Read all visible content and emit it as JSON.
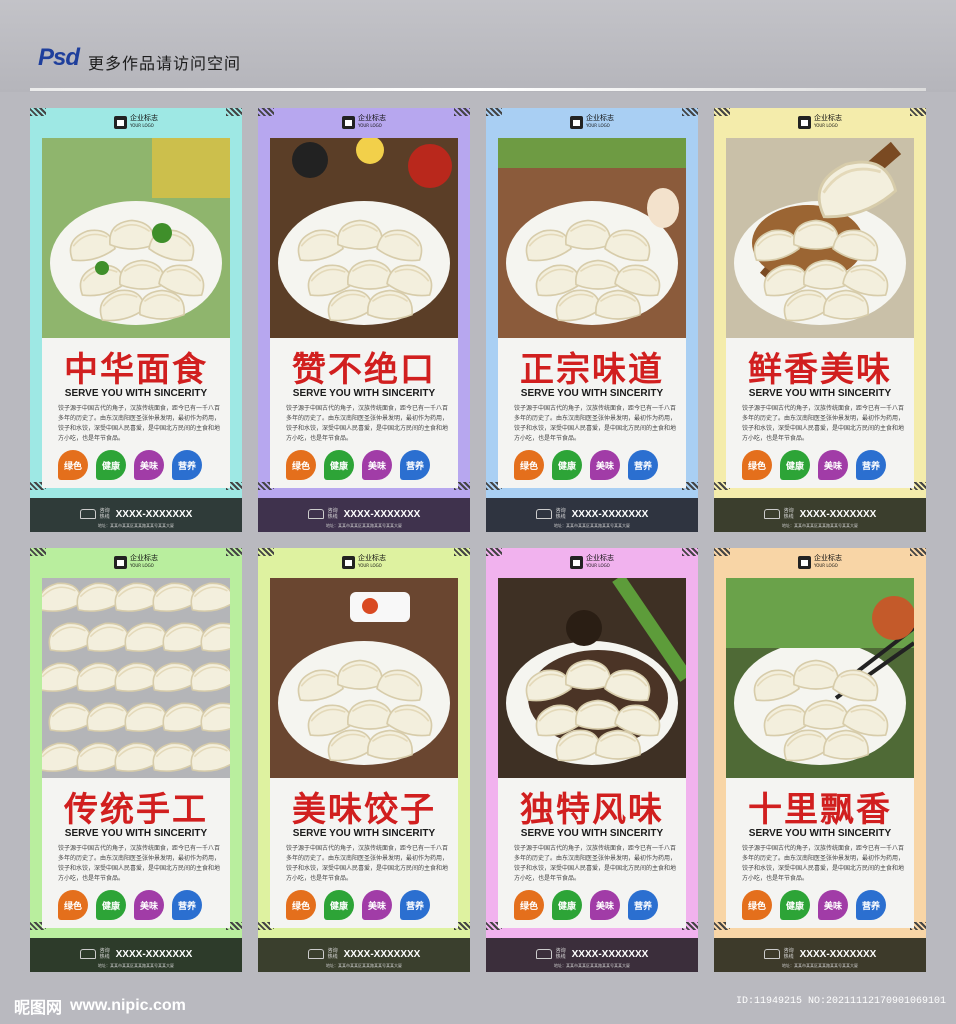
{
  "header": {
    "psd_logo": "Psd",
    "title": "更多作品请访问空间"
  },
  "posters": [
    {
      "headline": "中华面食",
      "frame_color": "#9ee8e4",
      "footer_color": "#2f3b39",
      "photo": "dumplings-parsley"
    },
    {
      "headline": "赞不绝口",
      "frame_color": "#b7a7ef",
      "footer_color": "#3f324d",
      "photo": "dumplings-bowl-chili"
    },
    {
      "headline": "正宗味道",
      "frame_color": "#a9cff3",
      "footer_color": "#2f3440",
      "photo": "dumplings-white-bowl"
    },
    {
      "headline": "鲜香美味",
      "frame_color": "#f4ecab",
      "footer_color": "#3b3e2d",
      "photo": "dumpling-spoon"
    },
    {
      "headline": "传统手工",
      "frame_color": "#b9ee9e",
      "footer_color": "#2d3b2a",
      "photo": "raw-dumplings-tray"
    },
    {
      "headline": "美味饺子",
      "frame_color": "#def2a0",
      "footer_color": "#3a3f2d",
      "photo": "fried-dumplings-plate"
    },
    {
      "headline": "独特风味",
      "frame_color": "#f1b2ee",
      "footer_color": "#3b2e3b",
      "photo": "dumplings-dark-plate"
    },
    {
      "headline": "十里飘香",
      "frame_color": "#f8d5a6",
      "footer_color": "#3d3a2a",
      "photo": "dumplings-chopsticks"
    }
  ],
  "common": {
    "logo_text": "企业标志",
    "logo_sub": "YOUR LOGO",
    "serve": "SERVE YOU WITH SINCERITY",
    "body": "饺子源于中国古代的角子，汉族传统面食，距今已有一千八百多年的历史了。由东汉南阳医圣张仲景发明，最初作为药用，饺子和水饺，深受中国人民喜爱，是中国北方民间的主食和地方小吃，也是年节食品。",
    "badges": [
      {
        "label": "绿色",
        "color": "#e46f1c"
      },
      {
        "label": "健康",
        "color": "#2da437"
      },
      {
        "label": "美味",
        "color": "#a13ca7"
      },
      {
        "label": "营养",
        "color": "#2b6fd0"
      }
    ],
    "phone_label": "咨询热线",
    "phone": "XXXX-XXXXXXX",
    "address": "地址：某某市某某区某某路某某号某某大厦"
  },
  "watermark": {
    "site_cn": "昵图网",
    "site_url": "www.nipic.com",
    "id": "ID:11949215 NO:20211112170901069101"
  }
}
